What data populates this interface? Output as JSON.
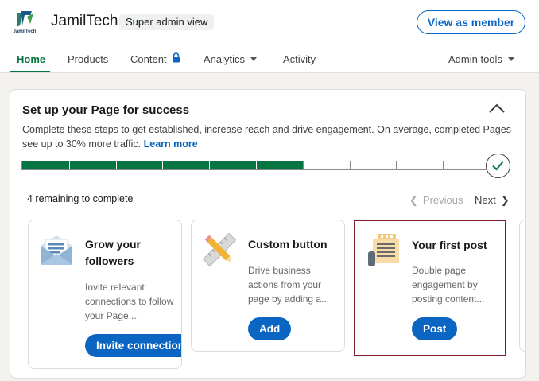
{
  "header": {
    "org_name": "JamilTech",
    "logo_text": "JamilTech",
    "admin_badge": "Super admin view",
    "view_as_member": "View as member"
  },
  "nav": {
    "items": [
      {
        "label": "Home",
        "active": true
      },
      {
        "label": "Products"
      },
      {
        "label": "Content",
        "icon": "lock-icon"
      },
      {
        "label": "Analytics",
        "icon": "chevron-down-icon"
      },
      {
        "label": "Activity"
      }
    ],
    "admin_tools": "Admin tools"
  },
  "setup": {
    "title": "Set up your Page for success",
    "description": "Complete these steps to get established, increase reach and drive engagement. On average, completed Pages see up to 30% more traffic.",
    "learn_more": "Learn more",
    "progress": {
      "completed_steps": 6,
      "total_steps": 10
    },
    "remaining": "4 remaining to complete",
    "previous": "Previous",
    "next": "Next"
  },
  "tasks": [
    {
      "title": "Grow your followers",
      "description": "Invite relevant connections to follow your Page....",
      "button": "Invite connections",
      "icon": "envelope-icon"
    },
    {
      "title": "Custom button",
      "description": "Drive business actions from your page by adding a...",
      "button": "Add",
      "icon": "ruler-pencil-icon"
    },
    {
      "title": "Your first post",
      "description": "Double page engagement by posting content...",
      "button": "Post",
      "icon": "document-icon",
      "highlighted": true
    }
  ],
  "colors": {
    "accent_green": "#057642",
    "link_blue": "#0a66c2",
    "highlight_border": "#7a1f2b"
  }
}
